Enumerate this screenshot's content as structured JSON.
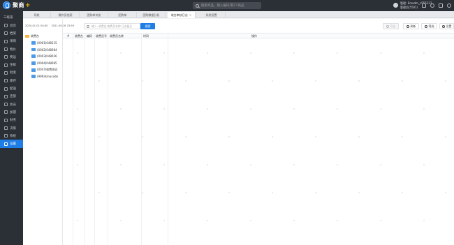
{
  "app": {
    "name": "聚商",
    "plus": "+"
  },
  "top_search": {
    "placeholder": "搜索商品，输入编码/客户/商品"
  },
  "user": {
    "line1": "管理: Emadm_c555123",
    "line2": "管理员(5501)"
  },
  "sidebar": {
    "section_label": "三级菜",
    "items": [
      {
        "label": "首页",
        "icon": "home-icon"
      },
      {
        "label": "档案",
        "icon": "archive-icon"
      },
      {
        "label": "采购",
        "icon": "cart-icon"
      },
      {
        "label": "物价",
        "icon": "price-icon"
      },
      {
        "label": "费运",
        "icon": "truck-icon"
      },
      {
        "label": "生鲜",
        "icon": "leaf-icon"
      },
      {
        "label": "批发",
        "icon": "box-icon"
      },
      {
        "label": "库存",
        "icon": "warehouse-icon"
      },
      {
        "label": "配送",
        "icon": "delivery-icon"
      },
      {
        "label": "连锁",
        "icon": "chain-icon"
      },
      {
        "label": "会员",
        "icon": "member-icon"
      },
      {
        "label": "加盟",
        "icon": "partner-icon"
      },
      {
        "label": "财务",
        "icon": "finance-icon"
      },
      {
        "label": "决策",
        "icon": "chart-icon"
      },
      {
        "label": "系统",
        "icon": "system-icon"
      },
      {
        "label": "设置",
        "icon": "settings-icon",
        "active": true
      }
    ]
  },
  "tabs": [
    {
      "label": "导航"
    },
    {
      "label": "操作员档案"
    },
    {
      "label": "团购单浏览"
    },
    {
      "label": "团购单"
    },
    {
      "label": "团购数据分析"
    },
    {
      "label": "收台审核日志",
      "active": true,
      "close": "×"
    },
    {
      "label": "系统设置"
    }
  ],
  "left_panel": {
    "date_start": "2020-01-01 00:00",
    "date_end": "2021-09-18 23:59",
    "tree_root": "收费台",
    "tree_items": [
      "(0001)048115",
      "(0002)048084",
      "(0003)048026",
      "(0004)048085",
      "(0047)收费测试",
      "(999)Ismocode"
    ]
  },
  "toolbar": {
    "search_placeholder": "输入: 收费台/收费员名称 日志备注",
    "search_button": "搜索",
    "export_label": "导出",
    "refresh_label": "刷新",
    "filter_label": "筛选",
    "settings_label": "设置"
  },
  "table": {
    "columns": [
      "#",
      "收费台",
      "编码",
      "收费员号",
      "收费员名称",
      "时间",
      "操作"
    ]
  }
}
